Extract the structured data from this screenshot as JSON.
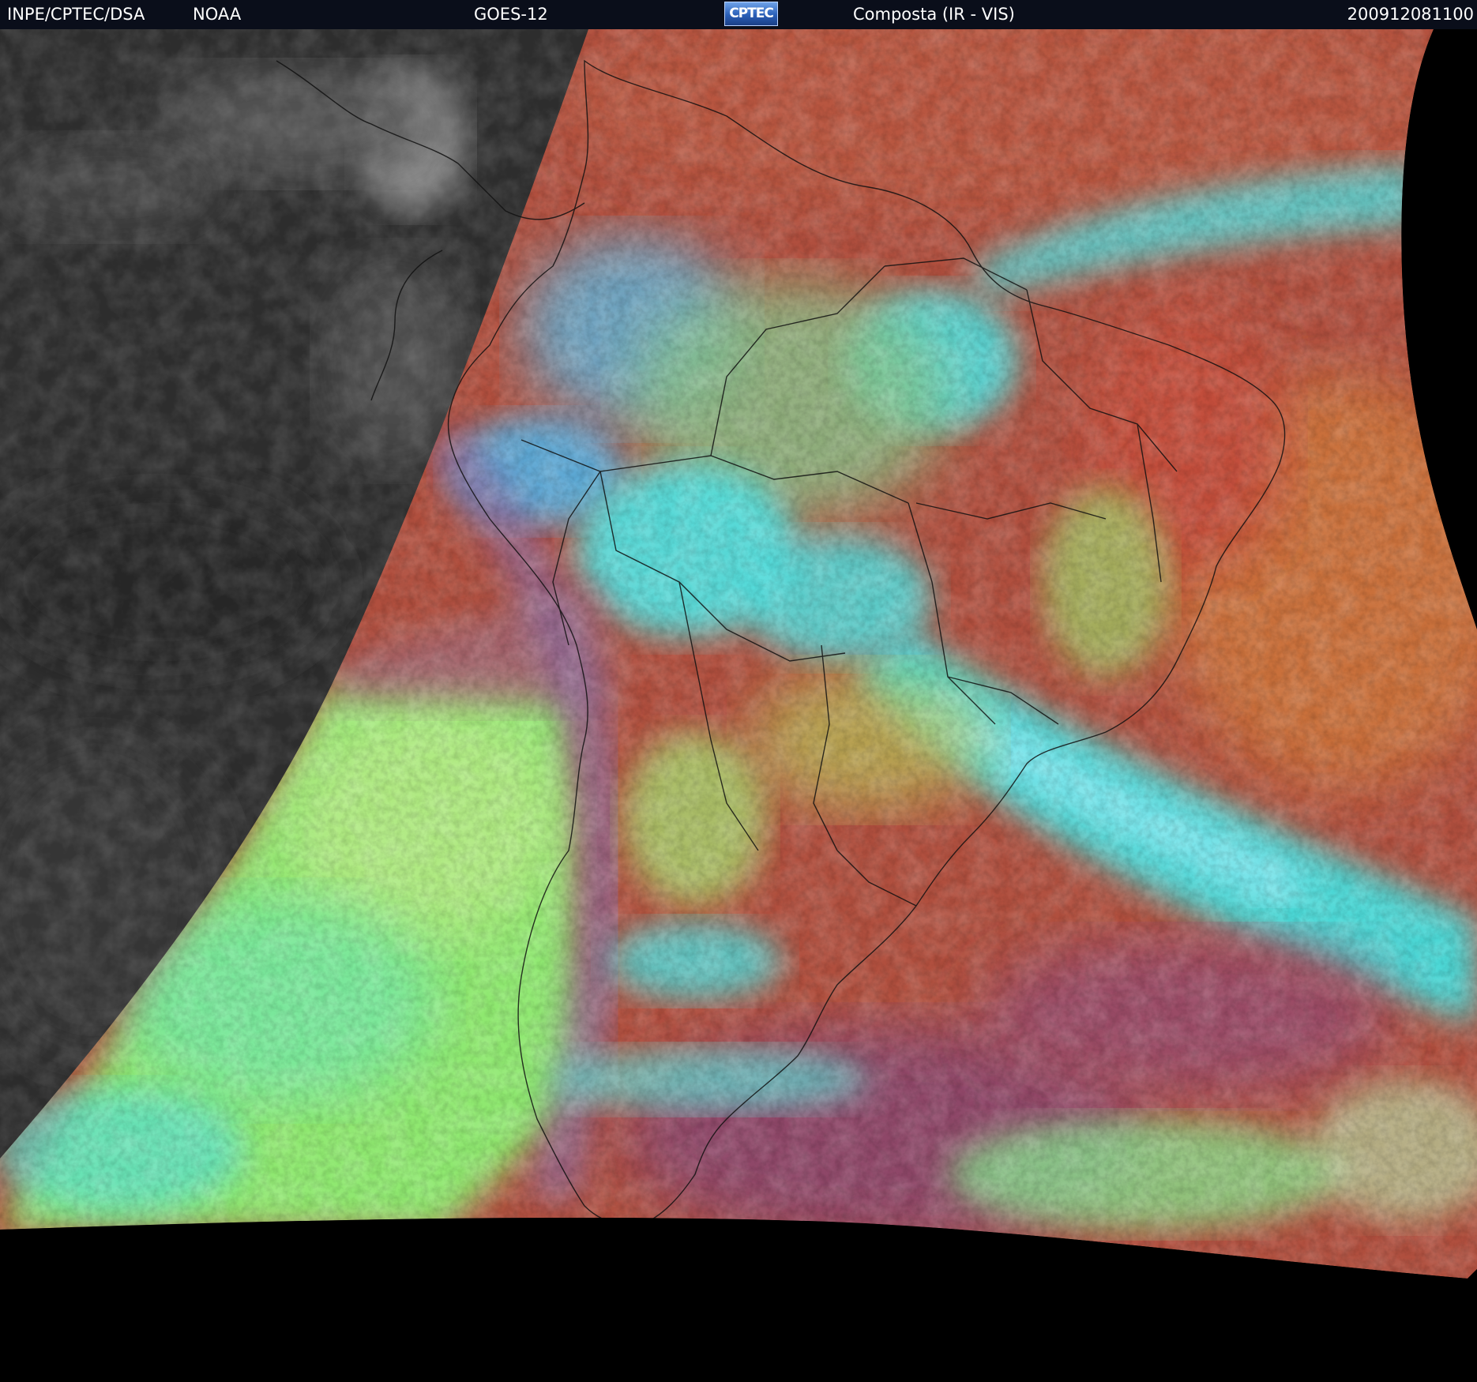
{
  "header": {
    "source": "INPE/CPTEC/DSA",
    "agency": "NOAA",
    "satellite": "GOES-12",
    "logo_text": "CPTEC",
    "product": "Composta (IR - VIS)",
    "datetime": "200912081100"
  },
  "colors": {
    "header_bg": "#0a0e1a",
    "background": "#000000",
    "ir_ocean": "#2e2e2e",
    "land_warm": "#b5533f",
    "high_cloud": "#3fe6e6",
    "low_cloud": "#8fe870",
    "south_ocean": "#8a4a66"
  },
  "icons": {
    "logo": "cptec-logo"
  }
}
